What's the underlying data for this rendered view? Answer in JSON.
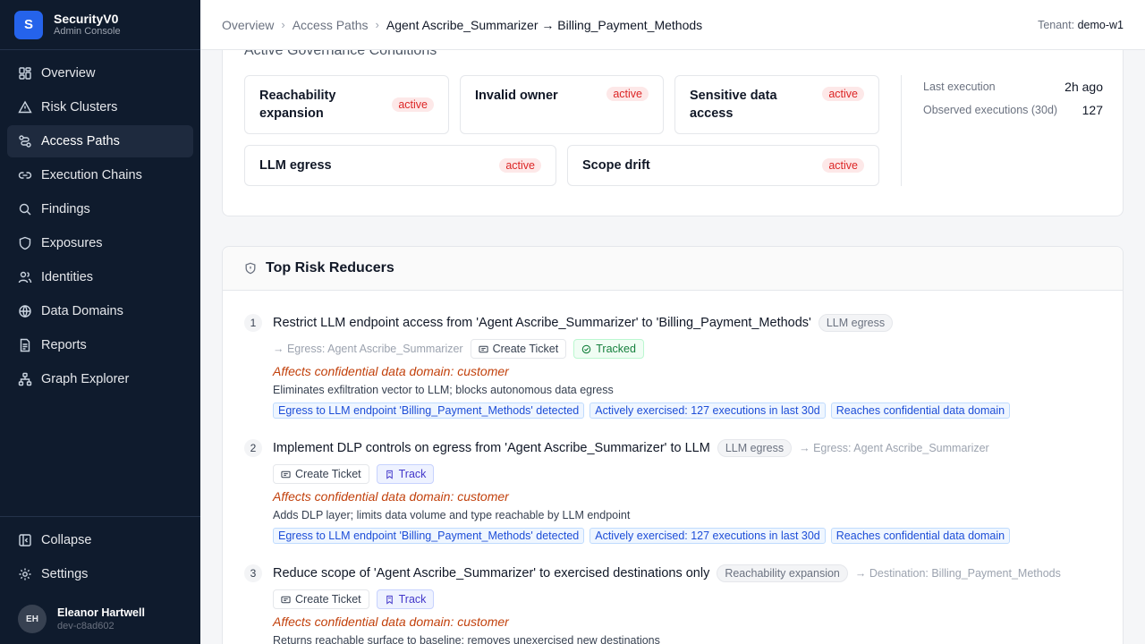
{
  "sidebar": {
    "brand_initial": "S",
    "brand_name": "SecurityV0",
    "brand_sub": "Admin Console",
    "items": [
      {
        "label": "Overview",
        "icon": "dashboard-icon"
      },
      {
        "label": "Risk Clusters",
        "icon": "warning-triangle-icon"
      },
      {
        "label": "Access Paths",
        "icon": "route-icon",
        "active": true
      },
      {
        "label": "Execution Chains",
        "icon": "link-icon"
      },
      {
        "label": "Findings",
        "icon": "search-icon"
      },
      {
        "label": "Exposures",
        "icon": "shield-icon"
      },
      {
        "label": "Identities",
        "icon": "users-icon"
      },
      {
        "label": "Data Domains",
        "icon": "globe-icon"
      },
      {
        "label": "Reports",
        "icon": "document-icon"
      },
      {
        "label": "Graph Explorer",
        "icon": "graph-icon"
      }
    ],
    "collapse_label": "Collapse",
    "settings_label": "Settings",
    "user": {
      "initials": "EH",
      "name": "Eleanor Hartwell",
      "id": "dev-c8ad602"
    }
  },
  "topbar": {
    "breadcrumbs": [
      "Overview",
      "Access Paths",
      "Agent Ascribe_Summarizer → Billing_Payment_Methods"
    ],
    "tenant_label": "Tenant:",
    "tenant_value": "demo-w1"
  },
  "governance": {
    "title": "Active Governance Conditions",
    "conditions": [
      {
        "name": "Reachability expansion",
        "status": "active"
      },
      {
        "name": "Invalid owner",
        "status": "active"
      },
      {
        "name": "Sensitive data access",
        "status": "active"
      },
      {
        "name": "LLM egress",
        "status": "active"
      },
      {
        "name": "Scope drift",
        "status": "active"
      }
    ],
    "stats": [
      {
        "label": "Last execution",
        "value": "2h ago"
      },
      {
        "label": "Observed executions (30d)",
        "value": "127"
      }
    ]
  },
  "reducers": {
    "title": "Top Risk Reducers",
    "items": [
      {
        "num": "1",
        "title": "Restrict LLM endpoint access from 'Agent Ascribe_Summarizer' to 'Billing_Payment_Methods'",
        "tag": "LLM egress",
        "meta": "→ Egress: Agent Ascribe_Summarizer",
        "ticket_label": "Create Ticket",
        "status_label": "Tracked",
        "affects": "Affects confidential data domain: customer",
        "description": "Eliminates exfiltration vector to LLM; blocks autonomous data egress",
        "evidence": [
          "Egress to LLM endpoint 'Billing_Payment_Methods' detected",
          "Actively exercised: 127 executions in last 30d",
          "Reaches confidential data domain"
        ]
      },
      {
        "num": "2",
        "title": "Implement DLP controls on egress from 'Agent Ascribe_Summarizer' to LLM",
        "tag": "LLM egress",
        "meta": "→ Egress: Agent Ascribe_Summarizer",
        "ticket_label": "Create Ticket",
        "status_label": "Track",
        "affects": "Affects confidential data domain: customer",
        "description": "Adds DLP layer; limits data volume and type reachable by LLM endpoint",
        "evidence": [
          "Egress to LLM endpoint 'Billing_Payment_Methods' detected",
          "Actively exercised: 127 executions in last 30d",
          "Reaches confidential data domain"
        ]
      },
      {
        "num": "3",
        "title": "Reduce scope of 'Agent Ascribe_Summarizer' to exercised destinations only",
        "tag": "Reachability expansion",
        "meta": "→ Destination: Billing_Payment_Methods",
        "ticket_label": "Create Ticket",
        "status_label": "Track",
        "affects": "Affects confidential data domain: customer",
        "description": "Returns reachable surface to baseline; removes unexercised new destinations"
      }
    ]
  }
}
